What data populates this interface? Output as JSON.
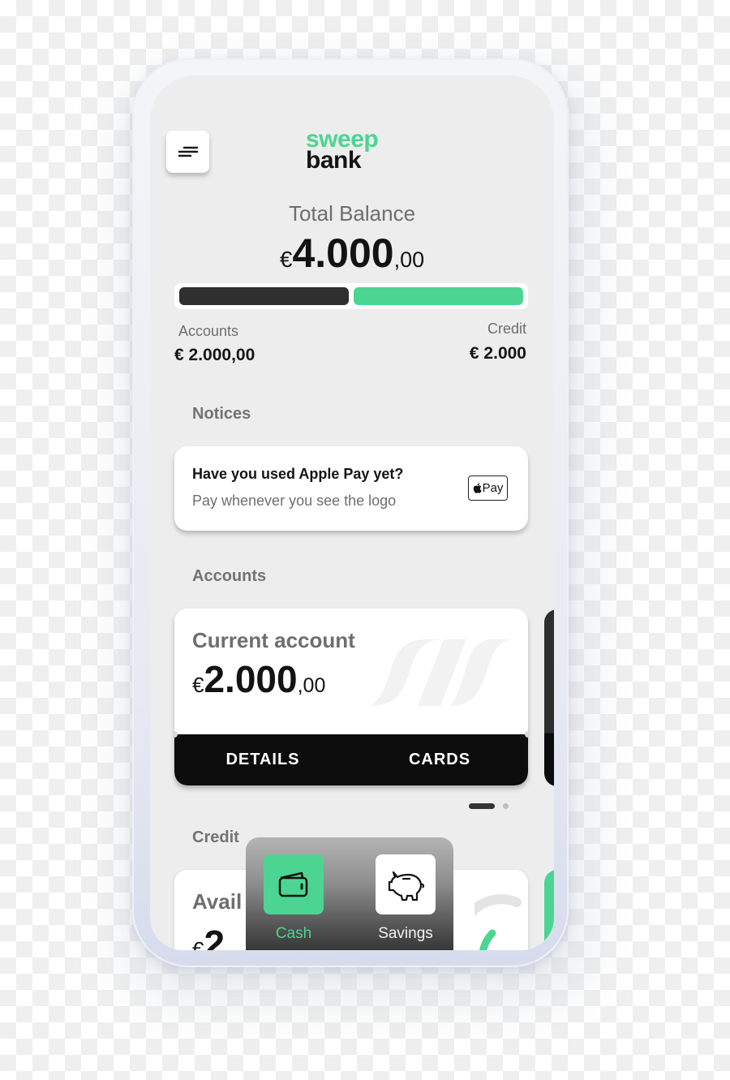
{
  "app": {
    "brand_line1": "sweep",
    "brand_line2": "bank",
    "menu_icon": "menu-icon"
  },
  "colors": {
    "brand_green": "#4cd592",
    "dark": "#2f2f2f",
    "black": "#0c0c0c",
    "screen_bg": "#ededed",
    "muted_text": "#6e6e6e"
  },
  "balance": {
    "label": "Total Balance",
    "currency": "€",
    "integer": "4.000",
    "decimals": ",00",
    "breakdown": {
      "accounts_share": 0.5,
      "credit_share": 0.5
    },
    "accounts_label": "Accounts",
    "accounts_value": "€ 2.000,00",
    "credit_label": "Credit",
    "credit_value": "€ 2.000"
  },
  "notices": {
    "section_title": "Notices",
    "items": [
      {
        "title": "Have you used Apple Pay yet?",
        "subtitle": "Pay whenever you see the logo",
        "badge_icon": "apple-pay-icon",
        "badge_text": "Pay"
      }
    ]
  },
  "accounts": {
    "section_title": "Accounts",
    "cards": [
      {
        "name": "Current account",
        "currency": "€",
        "integer": "2.000",
        "decimals": ",00",
        "actions": [
          "DETAILS",
          "CARDS"
        ]
      }
    ],
    "pager": {
      "total": 2,
      "active": 1
    }
  },
  "credit": {
    "section_title": "Credit",
    "card": {
      "title_partial": "Avail",
      "currency": "€",
      "integer_partial": "2."
    }
  },
  "quick_menu": {
    "items": [
      {
        "label": "Cash",
        "icon": "wallet-icon",
        "active": true
      },
      {
        "label": "Savings",
        "icon": "piggy-bank-icon",
        "active": false
      }
    ]
  }
}
